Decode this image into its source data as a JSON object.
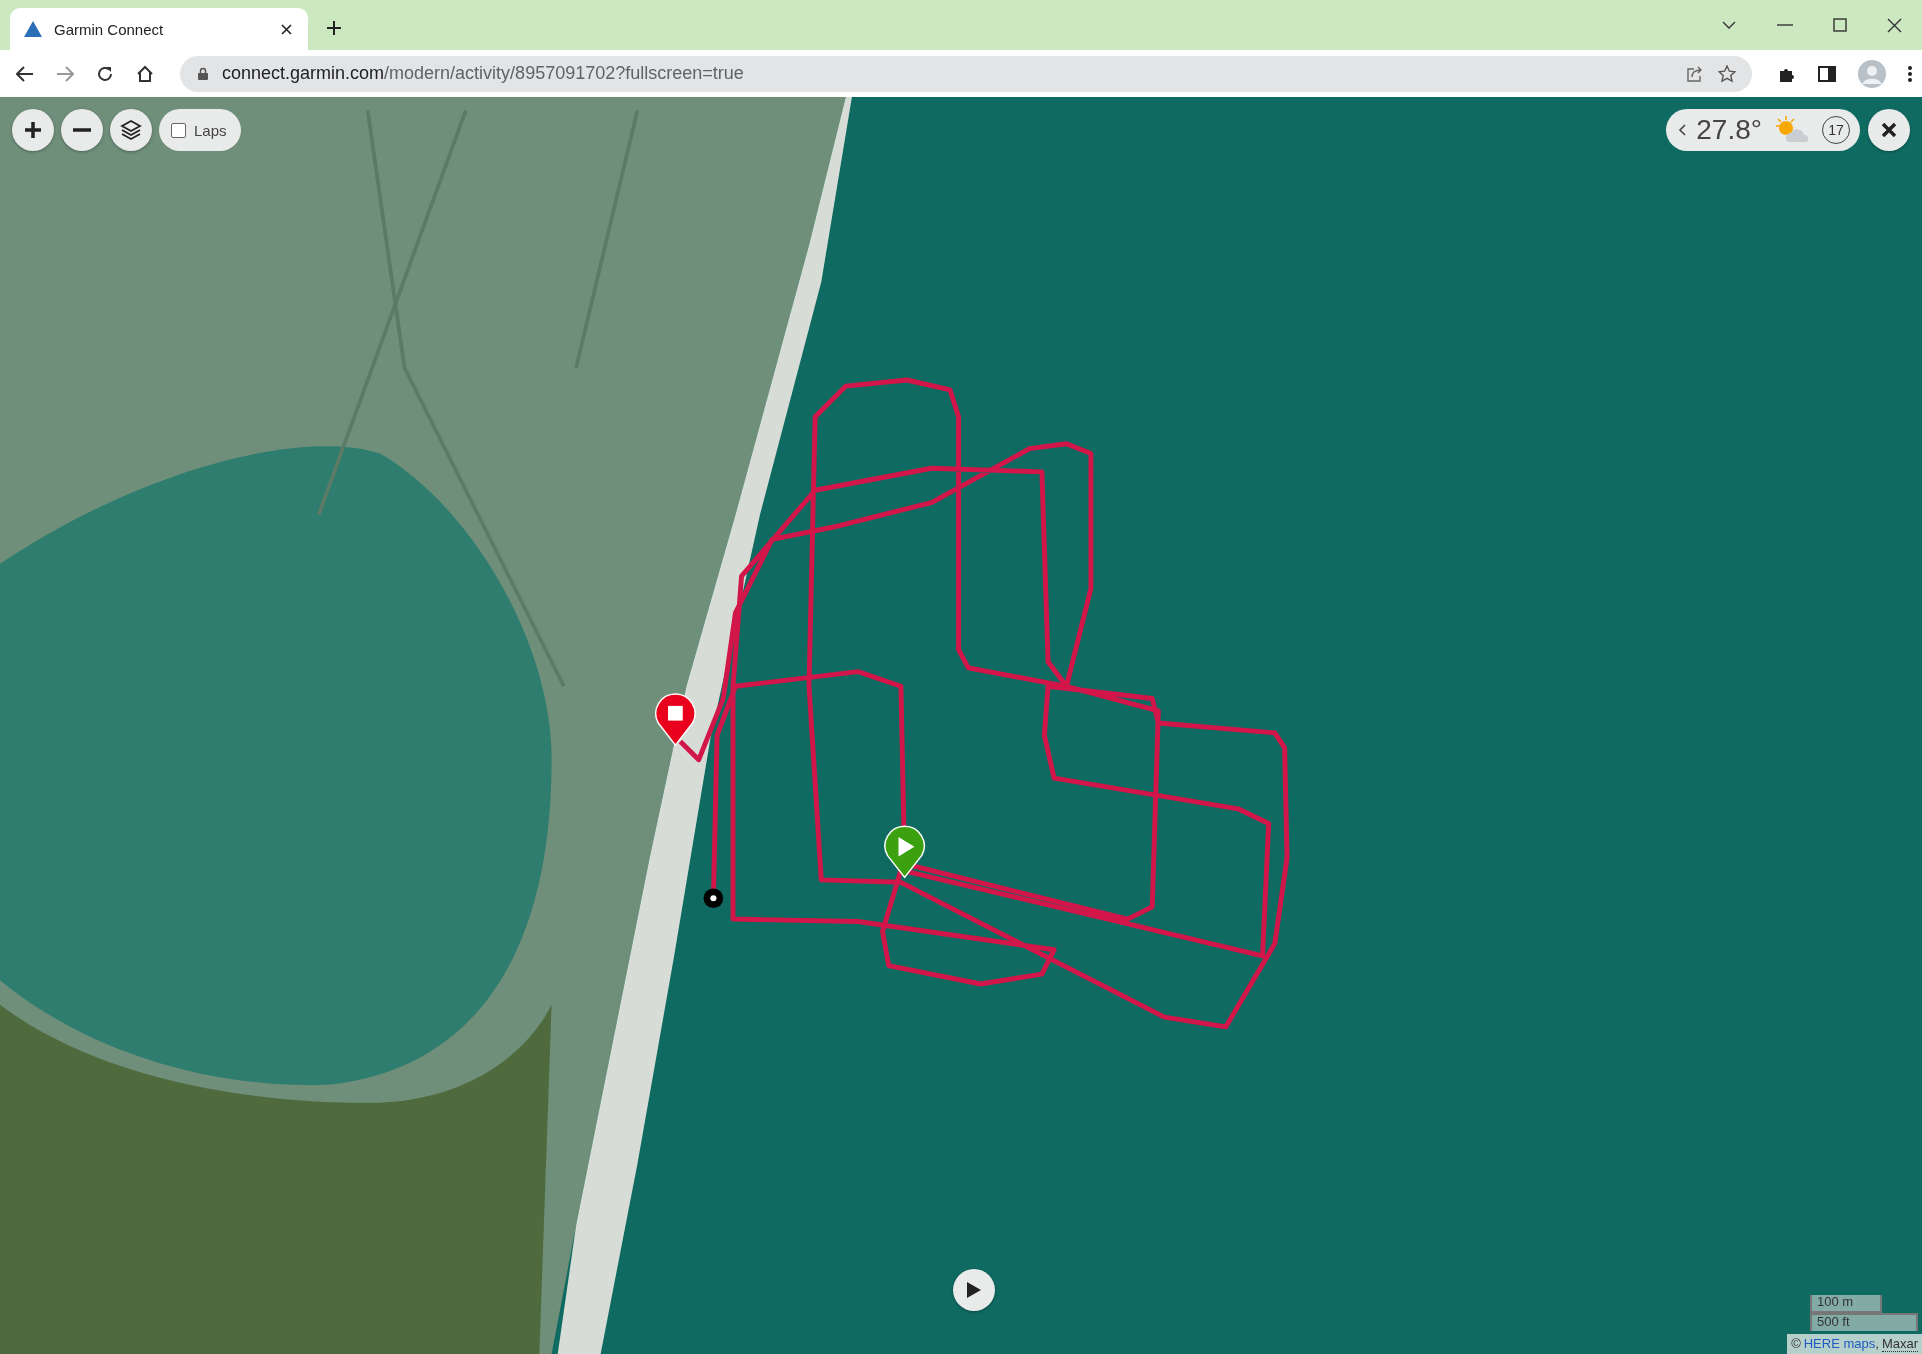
{
  "browser": {
    "tabs": [
      {
        "title": "Garmin Connect",
        "selected": true
      }
    ],
    "url_host": "connect.garmin.com",
    "url_path": "/modern/activity/8957091702?fullscreen=true"
  },
  "map_controls": {
    "laps": {
      "label": "Laps",
      "checked": false
    }
  },
  "weather": {
    "temperature": "27.8°",
    "wind_speed": "17"
  },
  "scale": [
    "100 m",
    "500 ft"
  ],
  "attribution": {
    "prefix": "©",
    "separator": ",",
    "links": [
      "HERE maps",
      "Maxar"
    ]
  }
}
